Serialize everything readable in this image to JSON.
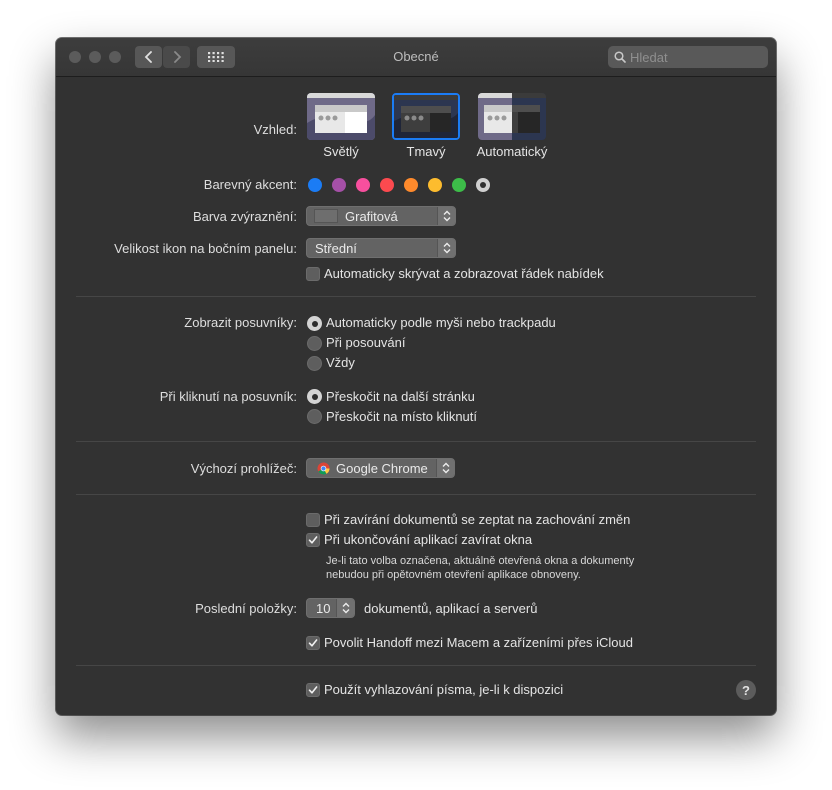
{
  "window": {
    "title": "Obecné"
  },
  "search": {
    "placeholder": "Hledat"
  },
  "appearance": {
    "label": "Vzhled:",
    "options": [
      {
        "label": "Světlý"
      },
      {
        "label": "Tmavý",
        "selected": true
      },
      {
        "label": "Automatický"
      }
    ]
  },
  "accent": {
    "label": "Barevný akcent:",
    "colors": [
      "#1b7cf5",
      "#a550a7",
      "#f74f9e",
      "#fc4a4f",
      "#fe8a2c",
      "#fdbc2e",
      "#3dbd49",
      "#8c8c8c"
    ],
    "selected_index": 7
  },
  "highlight": {
    "label": "Barva zvýraznění:",
    "value": "Grafitová"
  },
  "sidebar_icon_size": {
    "label": "Velikost ikon na bočním panelu:",
    "value": "Střední"
  },
  "menu_bar_autohide": {
    "label": "Automaticky skrývat a zobrazovat řádek nabídek",
    "checked": false
  },
  "scrollbars": {
    "label": "Zobrazit posuvníky:",
    "options": [
      {
        "label": "Automaticky podle myši nebo trackpadu",
        "selected": true
      },
      {
        "label": "Při posouvání",
        "selected": false
      },
      {
        "label": "Vždy",
        "selected": false
      }
    ]
  },
  "scrollbar_click": {
    "label": "Při kliknutí na posuvník:",
    "options": [
      {
        "label": "Přeskočit na další stránku",
        "selected": true
      },
      {
        "label": "Přeskočit na místo kliknutí",
        "selected": false
      }
    ]
  },
  "default_browser": {
    "label": "Výchozí prohlížeč:",
    "value": "Google Chrome",
    "icon": "chrome-icon"
  },
  "ask_keep_changes": {
    "label": "Při zavírání dokumentů se zeptat na zachování změn",
    "checked": false
  },
  "close_windows": {
    "label": "Při ukončování aplikací zavírat okna",
    "checked": true,
    "note_line1": "Je-li tato volba označena, aktuálně otevřená okna a dokumenty",
    "note_line2": "nebudou při opětovném otevření aplikace obnoveny."
  },
  "recent_items": {
    "label": "Poslední položky:",
    "value": "10",
    "suffix": "dokumentů, aplikací a serverů"
  },
  "handoff": {
    "label": "Povolit Handoff mezi Macem a zařízeními přes iCloud",
    "checked": true
  },
  "font_smoothing": {
    "label": "Použít vyhlazování písma, je-li k dispozici",
    "checked": true
  },
  "help": {
    "label": "?"
  },
  "colors": {
    "window_bg": "#323232",
    "titlebar": "#3a3a3a",
    "text": "#e4e4e4"
  }
}
